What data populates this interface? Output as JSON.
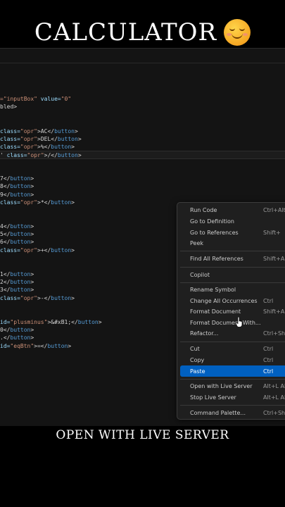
{
  "header": {
    "title": "CALCULATOR",
    "emoji_icon": "smiling-face-icon"
  },
  "caption": "OPEN WITH LIVE SERVER",
  "colors": {
    "attr": "#9cdcfe",
    "string": "#ce9178",
    "tag": "#569cd6",
    "text": "#d4d4d4",
    "menu_highlight": "#0060c0"
  },
  "code_lines": [
    [
      [
        "str",
        "=\"inputBox\" "
      ],
      [
        "attr",
        "value="
      ],
      [
        "str",
        "\"0\""
      ]
    ],
    [
      [
        "txt",
        "bled>"
      ]
    ],
    [
      [
        "attr",
        "class="
      ],
      [
        "str",
        "\"opr\""
      ],
      [
        "txt",
        ">AC</"
      ],
      [
        "tag",
        "button"
      ],
      [
        "txt",
        ">"
      ]
    ],
    [
      [
        "attr",
        "class="
      ],
      [
        "str",
        "\"opr\""
      ],
      [
        "txt",
        ">DEL</"
      ],
      [
        "tag",
        "button"
      ],
      [
        "txt",
        ">"
      ]
    ],
    [
      [
        "attr",
        "class="
      ],
      [
        "str",
        "\"opr\""
      ],
      [
        "txt",
        ">%</"
      ],
      [
        "tag",
        "button"
      ],
      [
        "txt",
        ">"
      ]
    ],
    [
      [
        "txt",
        "' "
      ],
      [
        "attr",
        "class="
      ],
      [
        "str",
        "\"opr\""
      ],
      [
        "txt",
        ">/</"
      ],
      [
        "tag",
        "button"
      ],
      [
        "txt",
        ">"
      ]
    ],
    [
      [
        "txt",
        "7</"
      ],
      [
        "tag",
        "button"
      ],
      [
        "txt",
        ">"
      ]
    ],
    [
      [
        "txt",
        "8</"
      ],
      [
        "tag",
        "button"
      ],
      [
        "txt",
        ">"
      ]
    ],
    [
      [
        "txt",
        "9</"
      ],
      [
        "tag",
        "button"
      ],
      [
        "txt",
        ">"
      ]
    ],
    [
      [
        "attr",
        "class="
      ],
      [
        "str",
        "\"opr\""
      ],
      [
        "txt",
        ">*</"
      ],
      [
        "tag",
        "button"
      ],
      [
        "txt",
        ">"
      ]
    ],
    [
      [
        "txt",
        "4</"
      ],
      [
        "tag",
        "button"
      ],
      [
        "txt",
        ">"
      ]
    ],
    [
      [
        "txt",
        "5</"
      ],
      [
        "tag",
        "button"
      ],
      [
        "txt",
        ">"
      ]
    ],
    [
      [
        "txt",
        "6</"
      ],
      [
        "tag",
        "button"
      ],
      [
        "txt",
        ">"
      ]
    ],
    [
      [
        "attr",
        "class="
      ],
      [
        "str",
        "\"opr\""
      ],
      [
        "txt",
        ">+</"
      ],
      [
        "tag",
        "button"
      ],
      [
        "txt",
        ">"
      ]
    ],
    [
      [
        "txt",
        "1</"
      ],
      [
        "tag",
        "button"
      ],
      [
        "txt",
        ">"
      ]
    ],
    [
      [
        "txt",
        "2</"
      ],
      [
        "tag",
        "button"
      ],
      [
        "txt",
        ">"
      ]
    ],
    [
      [
        "txt",
        "3</"
      ],
      [
        "tag",
        "button"
      ],
      [
        "txt",
        ">"
      ]
    ],
    [
      [
        "attr",
        "class="
      ],
      [
        "str",
        "\"opr\""
      ],
      [
        "txt",
        ">-</"
      ],
      [
        "tag",
        "button"
      ],
      [
        "txt",
        ">"
      ]
    ],
    [
      [
        "attr",
        "id="
      ],
      [
        "str",
        "\"plusminus\""
      ],
      [
        "txt",
        ">&#xB1;</"
      ],
      [
        "tag",
        "button"
      ],
      [
        "txt",
        ">"
      ]
    ],
    [
      [
        "txt",
        "0</"
      ],
      [
        "tag",
        "button"
      ],
      [
        "txt",
        ">"
      ]
    ],
    [
      [
        "txt",
        ".</"
      ],
      [
        "tag",
        "button"
      ],
      [
        "txt",
        ">"
      ]
    ],
    [
      [
        "attr",
        "id="
      ],
      [
        "str",
        "\"eqBtn\""
      ],
      [
        "txt",
        ">=</"
      ],
      [
        "tag",
        "button"
      ],
      [
        "txt",
        ">"
      ]
    ]
  ],
  "context_menu": [
    {
      "label": "Run Code",
      "shortcut": "Ctrl+Alt"
    },
    {
      "label": "Go to Definition",
      "shortcut": ""
    },
    {
      "label": "Go to References",
      "shortcut": "Shift+"
    },
    {
      "label": "Peek",
      "shortcut": ""
    },
    {
      "label": "Find All References",
      "shortcut": "Shift+Alt+"
    },
    {
      "label": "Copilot",
      "shortcut": ""
    },
    {
      "label": "Rename Symbol",
      "shortcut": ""
    },
    {
      "label": "Change All Occurrences",
      "shortcut": "Ctrl"
    },
    {
      "label": "Format Document",
      "shortcut": "Shift+Alt"
    },
    {
      "label": "Format Document With...",
      "shortcut": ""
    },
    {
      "label": "Refactor...",
      "shortcut": "Ctrl+Shift"
    },
    {
      "label": "Cut",
      "shortcut": "Ctrl"
    },
    {
      "label": "Copy",
      "shortcut": "Ctrl"
    },
    {
      "label": "Paste",
      "shortcut": "Ctrl"
    },
    {
      "label": "Open with Live Server",
      "shortcut": "Alt+L Alt"
    },
    {
      "label": "Stop Live Server",
      "shortcut": "Alt+L Alt"
    },
    {
      "label": "Command Palette...",
      "shortcut": "Ctrl+Shift"
    }
  ]
}
